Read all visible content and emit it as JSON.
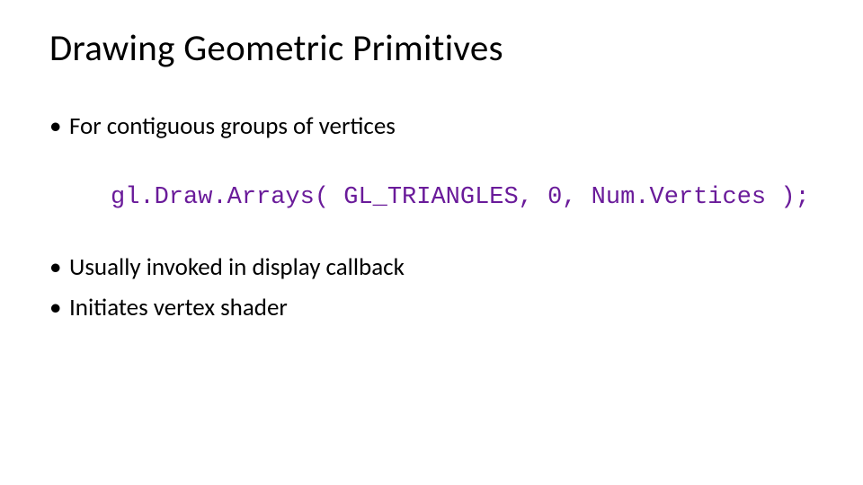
{
  "title": "Drawing Geometric Primitives",
  "bullets_top": [
    "For contiguous groups of vertices"
  ],
  "code": "gl.Draw.Arrays( GL_TRIANGLES, 0, Num.Vertices );",
  "bullets_bottom": [
    "Usually invoked in display callback",
    "Initiates vertex shader"
  ]
}
